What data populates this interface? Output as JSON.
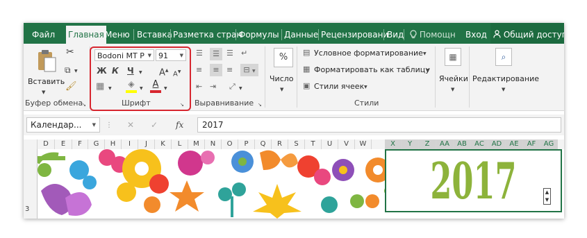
{
  "menu": {
    "tabs": [
      "Файл",
      "Главная",
      "Меню",
      "Вставка",
      "Разметка стран",
      "Формулы",
      "Данные",
      "Рецензировани",
      "Вид"
    ],
    "help_label": "Помощн",
    "login_label": "Вход",
    "share_label": "Общий доступ"
  },
  "ribbon": {
    "clipboard": {
      "paste_label": "Вставить",
      "group_label": "Буфер обмена"
    },
    "font": {
      "font_name": "Bodoni MT P",
      "font_size": "91",
      "bold": "Ж",
      "italic": "К",
      "underline": "Ч",
      "grow": "A",
      "shrink": "A",
      "font_color_letter": "A",
      "group_label": "Шрифт",
      "font_color": "#d7262f",
      "highlight_color": "#ffff00"
    },
    "alignment": {
      "group_label": "Выравнивание"
    },
    "number": {
      "label": "Число",
      "icon_text": "%"
    },
    "styles": {
      "conditional": "Условное форматирование",
      "as_table": "Форматировать как таблицу",
      "cell_styles": "Стили ячеек",
      "group_label": "Стили"
    },
    "cells": {
      "label": "Ячейки"
    },
    "editing": {
      "label": "Редактирование"
    }
  },
  "formula_bar": {
    "name_box": "Календар...",
    "fx": "fx",
    "value": "2017"
  },
  "columns": [
    "D",
    "E",
    "F",
    "G",
    "H",
    "I",
    "J",
    "K",
    "L",
    "M",
    "N",
    "O",
    "P",
    "Q",
    "R",
    "S",
    "T",
    "U",
    "V",
    "W",
    "X",
    "Y",
    "Z",
    "AA",
    "AB",
    "AC",
    "AD",
    "AE",
    "AF",
    "AG"
  ],
  "selected_columns": [
    "X",
    "Y",
    "Z",
    "AA",
    "AB",
    "AC",
    "AD",
    "AE",
    "AF",
    "AG"
  ],
  "row_number": "3",
  "cell": {
    "year": "2017",
    "year_color": "#8db33b"
  },
  "colors": {
    "accent": "#217346",
    "highlight_frame": "#d7262f"
  }
}
